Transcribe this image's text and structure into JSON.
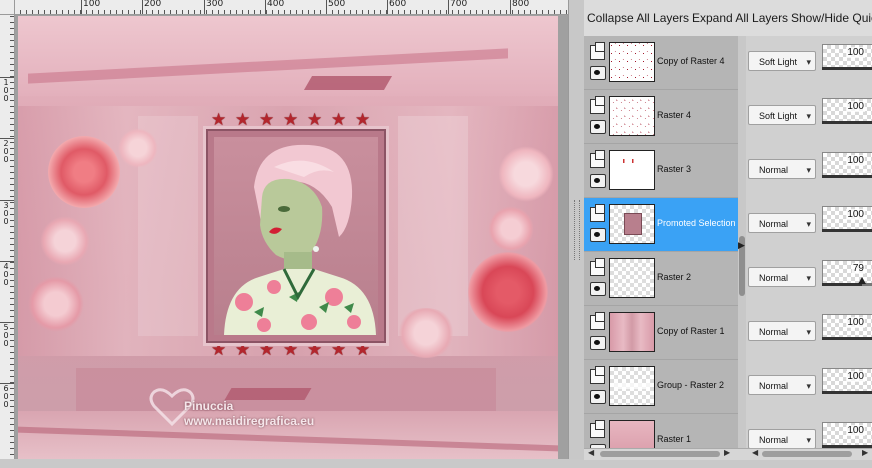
{
  "toolbar": {
    "collapse_all": "Collapse All Layers",
    "expand_all": "Expand All Layers",
    "show_hide": "Show/Hide Quic"
  },
  "ruler": {
    "h_labels": [
      "100",
      "200",
      "300",
      "400",
      "500",
      "600",
      "700",
      "800"
    ],
    "v_labels": [
      "1 0 0",
      "2 0 0",
      "3 0 0",
      "4 0 0",
      "5 0 0",
      "6 0 0"
    ]
  },
  "canvas": {
    "watermark_name": "Pinuccia",
    "watermark_url": "www.maidiregrafica.eu",
    "star_count_top": 7,
    "star_count_bottom": 7
  },
  "layers": [
    {
      "name": "Copy of Raster 4",
      "blend": "Soft Light",
      "opacity": "100",
      "selected": false
    },
    {
      "name": "Raster 4",
      "blend": "Soft Light",
      "opacity": "100",
      "selected": false
    },
    {
      "name": "Raster 3",
      "blend": "Normal",
      "opacity": "100",
      "selected": false
    },
    {
      "name": "Promoted Selection",
      "blend": "Normal",
      "opacity": "100",
      "selected": true
    },
    {
      "name": "Raster 2",
      "blend": "Normal",
      "opacity": "79",
      "selected": false
    },
    {
      "name": "Copy of Raster 1",
      "blend": "Normal",
      "opacity": "100",
      "selected": false
    },
    {
      "name": "Group - Raster 2",
      "blend": "Normal",
      "opacity": "100",
      "selected": false
    },
    {
      "name": "Raster 1",
      "blend": "Normal",
      "opacity": "100",
      "selected": false
    }
  ],
  "colors": {
    "selection": "#3aa2f5",
    "star": "#b3262d",
    "canvas_pink": "#dda6b3"
  }
}
